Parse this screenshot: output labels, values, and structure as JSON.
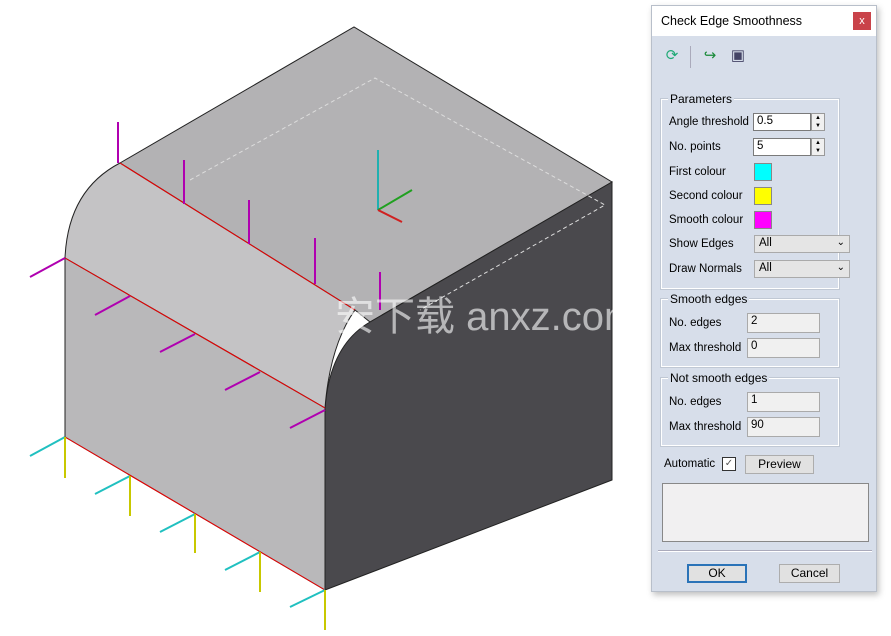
{
  "viewport": {
    "watermark": "安下载 anxz.com",
    "colors": {
      "top": "#b3b2b4",
      "front": "#b9b8ba",
      "side": "#4a494d",
      "normals": "#b000b0",
      "first": "#00ffff",
      "second": "#ffff00",
      "edge": "#e00000"
    }
  },
  "dialog": {
    "title": "Check Edge Smoothness",
    "close_label": "x",
    "toolbar": [
      {
        "icon": "refresh-icon"
      },
      {
        "icon": "open-icon"
      },
      {
        "icon": "save-icon"
      }
    ],
    "parameters": {
      "title": "Parameters",
      "angle_threshold": {
        "label": "Angle threshold",
        "value": "0.5"
      },
      "no_points": {
        "label": "No. points",
        "value": "5"
      },
      "first_colour": {
        "label": "First colour",
        "color": "#00ffff"
      },
      "second_colour": {
        "label": "Second colour",
        "color": "#ffff00"
      },
      "smooth_colour": {
        "label": "Smooth colour",
        "color": "#ff00ff"
      },
      "show_edges": {
        "label": "Show Edges",
        "value": "All"
      },
      "draw_normals": {
        "label": "Draw Normals",
        "value": "All"
      }
    },
    "smooth_edges": {
      "title": "Smooth edges",
      "no_edges_label": "No. edges",
      "no_edges": "2",
      "max_threshold_label": "Max threshold",
      "max_threshold": "0"
    },
    "not_smooth_edges": {
      "title": "Not smooth edges",
      "no_edges_label": "No. edges",
      "no_edges": "1",
      "max_threshold_label": "Max threshold",
      "max_threshold": "90"
    },
    "automatic": {
      "label": "Automatic",
      "checked": true
    },
    "preview_label": "Preview",
    "ok_label": "OK",
    "cancel_label": "Cancel"
  }
}
